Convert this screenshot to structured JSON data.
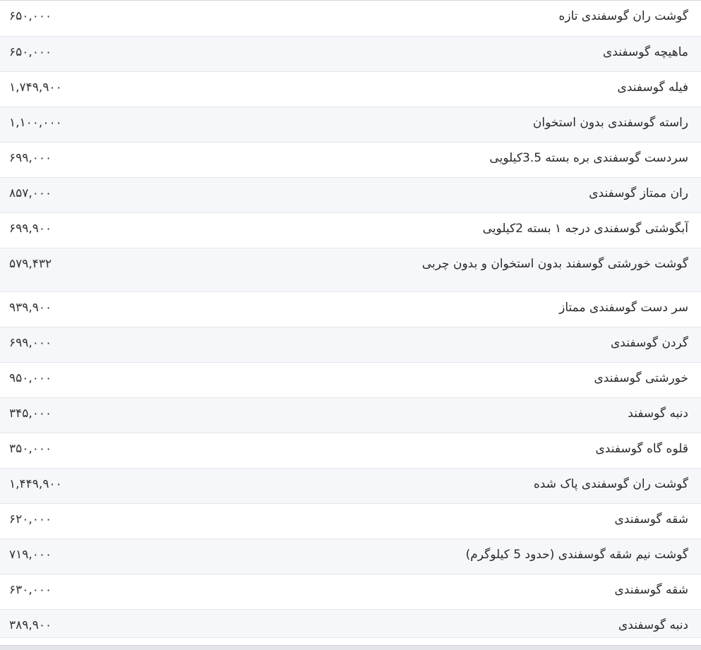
{
  "rows": [
    {
      "name": "گوشت ران گوسفندی تازه",
      "price": "۶۵۰,۰۰۰"
    },
    {
      "name": "ماهیچه گوسفندی",
      "price": "۶۵۰,۰۰۰"
    },
    {
      "name": "فیله گوسفندی",
      "price": "۱,۷۴۹,۹۰۰"
    },
    {
      "name": "راسته گوسفندی بدون استخوان",
      "price": "۱,۱۰۰,۰۰۰"
    },
    {
      "name": "سردست گوسفندی بره بسته 3.5کیلویی",
      "price": "۶۹۹,۰۰۰"
    },
    {
      "name": "ران ممتاز گوسفندی",
      "price": "۸۵۷,۰۰۰"
    },
    {
      "name": "آبگوشتی گوسفندی درجه ۱ بسته 2کیلویی",
      "price": "۶۹۹,۹۰۰"
    },
    {
      "name": "گوشت خورشتی گوسفند بدون استخوان و بدون چربی",
      "price": "۵۷۹,۴۳۲"
    },
    {
      "name": "سر دست گوسفندی ممتاز",
      "price": "۹۳۹,۹۰۰"
    },
    {
      "name": "گردن گوسفندی",
      "price": "۶۹۹,۰۰۰"
    },
    {
      "name": "خورشتی گوسفندی",
      "price": "۹۵۰,۰۰۰"
    },
    {
      "name": "دنبه گوسفند",
      "price": "۳۴۵,۰۰۰"
    },
    {
      "name": "قلوه گاه گوسفندی",
      "price": "۳۵۰,۰۰۰"
    },
    {
      "name": "گوشت ران گوسفندی پاک شده",
      "price": "۱,۴۴۹,۹۰۰"
    },
    {
      "name": "شقه گوسفندی",
      "price": "۶۲۰,۰۰۰"
    },
    {
      "name": "گوشت نیم شقه گوسفندی (حدود 5 کیلوگرم)",
      "price": "۷۱۹,۰۰۰"
    },
    {
      "name": "شقه گوسفندی",
      "price": "۶۳۰,۰۰۰"
    },
    {
      "name": "دنبه گوسفندی",
      "price": "۳۸۹,۹۰۰"
    }
  ]
}
